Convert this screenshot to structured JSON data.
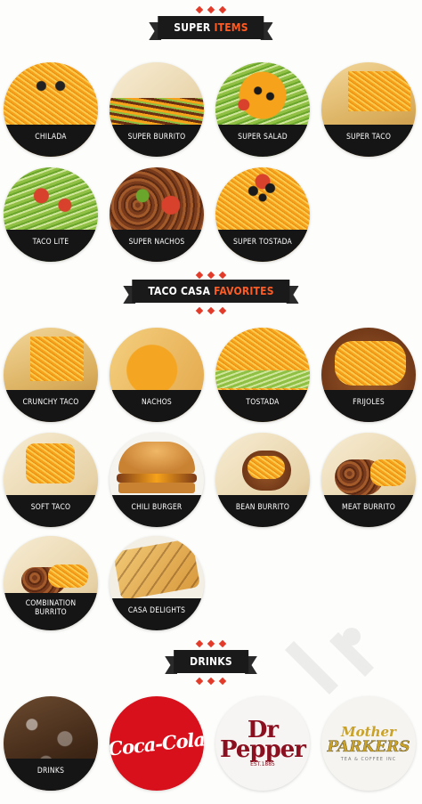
{
  "sections": {
    "super_items": {
      "title_main": "SUPER",
      "title_accent": "ITEMS"
    },
    "favorites": {
      "title_main": "TACO CASA",
      "title_accent": "FAVORITES"
    },
    "drinks": {
      "title_main": "DRINKS"
    }
  },
  "super_items": [
    "CHILADA",
    "SUPER BURRITO",
    "SUPER SALAD",
    "SUPER TACO",
    "TACO LITE",
    "SUPER NACHOS",
    "SUPER TOSTADA"
  ],
  "favorites": [
    "CRUNCHY TACO",
    "NACHOS",
    "TOSTADA",
    "FRIJOLES",
    "SOFT TACO",
    "CHILI BURGER",
    "BEAN BURRITO",
    "MEAT BURRITO",
    "COMBINATION BURRITO",
    "CASA DELIGHTS"
  ],
  "drinks": {
    "drinks_label": "DRINKS",
    "coke_logo": "Coca-Cola",
    "drpepper_line1": "Dr",
    "drpepper_line2": "Pepper",
    "drpepper_sub": "EST.1885",
    "mother_line1": "Mother",
    "mother_line2": "PARKERS",
    "mother_sub": "TEA & COFFEE INC"
  },
  "colors": {
    "banner": "#1a1a1a",
    "accent": "#ff5b24",
    "label_band": "#151515",
    "coke_red": "#d8101c",
    "drpepper": "#8a1020",
    "mother_gold": "#c9a227"
  }
}
